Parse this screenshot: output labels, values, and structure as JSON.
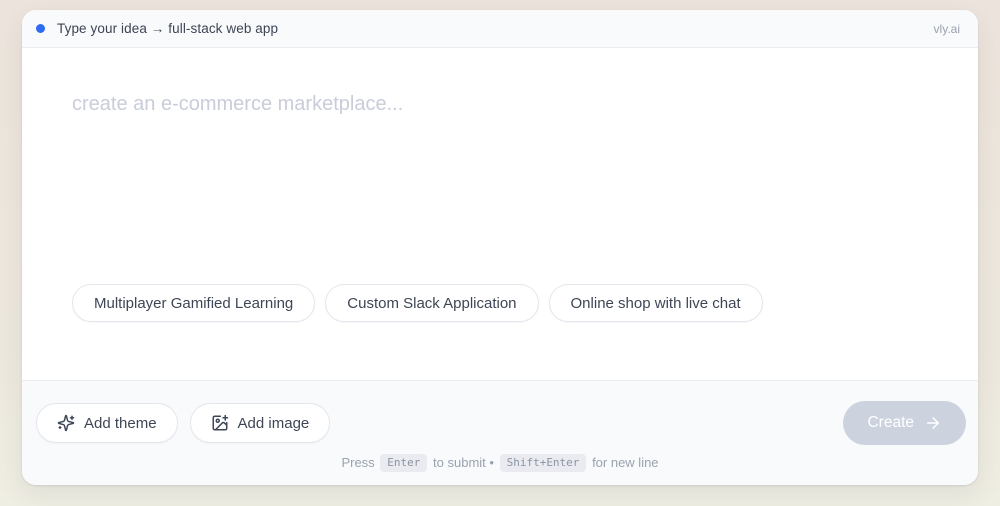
{
  "header": {
    "title": "Type your idea → full-stack web app",
    "brand": "vly.ai",
    "dot_color": "#2e6bf4"
  },
  "editor": {
    "placeholder": "create an e-commerce marketplace...",
    "value": ""
  },
  "suggestions": [
    {
      "label": "Multiplayer Gamified Learning"
    },
    {
      "label": "Custom Slack Application"
    },
    {
      "label": "Online shop with live chat"
    }
  ],
  "toolbar": {
    "add_theme_label": "Add theme",
    "add_image_label": "Add image",
    "create_label": "Create",
    "create_state": "disabled",
    "create_bg": "#ccd3de"
  },
  "hint": {
    "press": "Press",
    "enter_key": "Enter",
    "to_submit": "to submit •",
    "shift_enter_key": "Shift+Enter",
    "for_new_line": "for new line"
  }
}
